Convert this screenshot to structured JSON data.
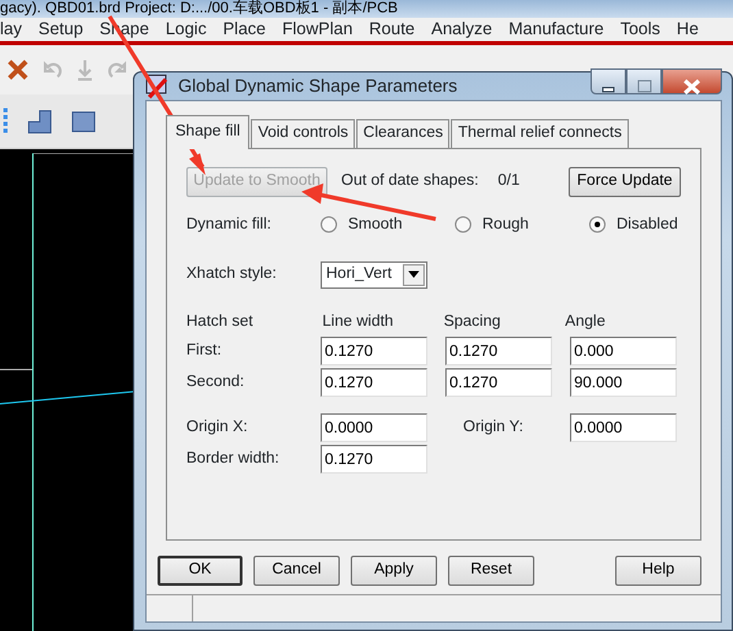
{
  "app_title": "gacy). QBD01.brd  Project: D:.../00.车载OBD板1 - 副本/PCB",
  "menu": [
    "lay",
    "Setup",
    "Shape",
    "Logic",
    "Place",
    "FlowPlan",
    "Route",
    "Analyze",
    "Manufacture",
    "Tools",
    "He"
  ],
  "dialog": {
    "title": "Global Dynamic Shape Parameters",
    "tabs": [
      {
        "label": "Shape fill",
        "selected": true
      },
      {
        "label": "Void controls",
        "selected": false
      },
      {
        "label": "Clearances",
        "selected": false
      },
      {
        "label": "Thermal relief connects",
        "selected": false
      }
    ],
    "update_button": {
      "label": "Update to Smooth",
      "disabled": true
    },
    "out_of_date": {
      "label": "Out of date shapes:",
      "value": "0/1"
    },
    "force_button": "Force Update",
    "dynamic_fill": {
      "label": "Dynamic fill:",
      "options": [
        {
          "label": "Smooth",
          "selected": false
        },
        {
          "label": "Rough",
          "selected": false
        },
        {
          "label": "Disabled",
          "selected": true
        }
      ]
    },
    "xhatch": {
      "label": "Xhatch style:",
      "value": "Hori_Vert"
    },
    "hatch_headers": [
      "Hatch set",
      "Line width",
      "Spacing",
      "Angle"
    ],
    "hatch_rows": [
      {
        "label": "First:",
        "values": [
          "0.1270",
          "0.1270",
          "0.000"
        ]
      },
      {
        "label": "Second:",
        "values": [
          "0.1270",
          "0.1270",
          "90.000"
        ]
      }
    ],
    "origin_x": {
      "label": "Origin X:",
      "value": "0.0000"
    },
    "origin_y": {
      "label": "Origin Y:",
      "value": "0.0000"
    },
    "border_width": {
      "label": "Border width:",
      "value": "0.1270"
    },
    "buttons": [
      "OK",
      "Cancel",
      "Apply",
      "Reset",
      "Help"
    ]
  }
}
